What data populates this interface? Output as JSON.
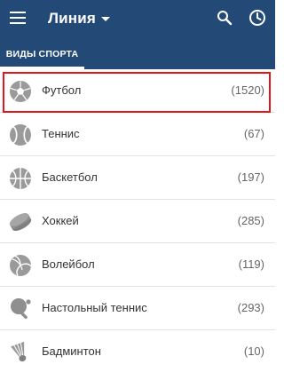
{
  "header": {
    "title": "Линия",
    "menu_icon": "menu-icon",
    "search_icon": "search-icon",
    "history_icon": "clock-icon",
    "background": "#234a77"
  },
  "tabs": [
    {
      "label": "ВИДЫ СПОРТА",
      "active": true
    }
  ],
  "sports": [
    {
      "name": "Футбол",
      "count": "(1520)",
      "icon": "soccer-ball-icon",
      "highlighted": true
    },
    {
      "name": "Теннис",
      "count": "(67)",
      "icon": "tennis-ball-icon"
    },
    {
      "name": "Баскетбол",
      "count": "(197)",
      "icon": "basketball-icon"
    },
    {
      "name": "Хоккей",
      "count": "(285)",
      "icon": "hockey-puck-icon"
    },
    {
      "name": "Волейбол",
      "count": "(119)",
      "icon": "volleyball-icon"
    },
    {
      "name": "Настольный теннис",
      "count": "(293)",
      "icon": "table-tennis-icon"
    },
    {
      "name": "Бадминтон",
      "count": "(10)",
      "icon": "shuttlecock-icon"
    }
  ],
  "colors": {
    "highlight_border": "#e0161b",
    "icon_gray": "#8f8f8f"
  }
}
